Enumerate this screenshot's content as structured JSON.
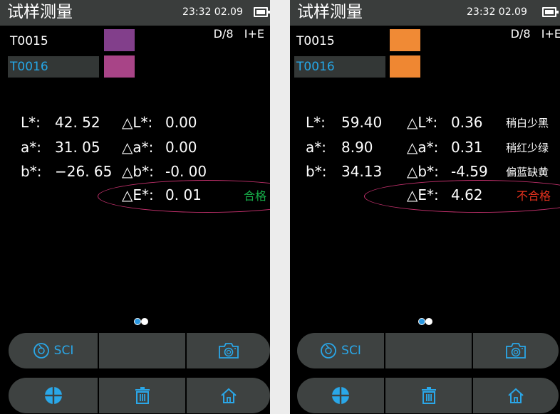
{
  "colors": {
    "accent": "#2aa7e8",
    "pass": "#16b04a",
    "fail": "#e8321e",
    "ellipse": "#c6316e",
    "bar": "#3e4241"
  },
  "panels": [
    {
      "title": "试样测量",
      "time": "23:32 02.09",
      "mode": "D/8   I+E",
      "samples": [
        {
          "name": "T0015",
          "color": "#823f8b"
        },
        {
          "name": "T0016",
          "color": "#a84487"
        }
      ],
      "metrics": [
        {
          "label": "L*:",
          "value": "42. 52",
          "delta_label": "△L*:",
          "delta_value": "0.00",
          "note": ""
        },
        {
          "label": "a*:",
          "value": "31. 05",
          "delta_label": "△a*:",
          "delta_value": "0.00",
          "note": ""
        },
        {
          "label": "b*:",
          "value": "−26. 65",
          "delta_label": "△b*:",
          "delta_value": "-0. 00",
          "note": ""
        }
      ],
      "delta_e": {
        "label": "△E*:",
        "value": "0. 01"
      },
      "verdict": {
        "text": "合格",
        "status": "pass"
      },
      "sci_label": "SCI",
      "icons": [
        "sci-icon",
        "camera-icon",
        "crosshair-icon",
        "trash-icon",
        "home-icon"
      ]
    },
    {
      "title": "试样测量",
      "time": "23:32 02.09",
      "mode": "D/8   I+E",
      "samples": [
        {
          "name": "T0015",
          "color": "#f08a35"
        },
        {
          "name": "T0016",
          "color": "#ef8732"
        }
      ],
      "metrics": [
        {
          "label": "L*:",
          "value": "59.40",
          "delta_label": "△L*:",
          "delta_value": "0.36",
          "note": "稍白少黑"
        },
        {
          "label": "a*:",
          "value": "8.90",
          "delta_label": "△a*:",
          "delta_value": "0.31",
          "note": "稍红少绿"
        },
        {
          "label": "b*:",
          "value": "34.13",
          "delta_label": "△b*:",
          "delta_value": "-4.59",
          "note": "偏蓝缺黄"
        }
      ],
      "delta_e": {
        "label": "△E*:",
        "value": "4.62"
      },
      "verdict": {
        "text": "不合格",
        "status": "fail"
      },
      "sci_label": "SCI",
      "icons": [
        "sci-icon",
        "camera-icon",
        "crosshair-icon",
        "trash-icon",
        "home-icon"
      ]
    }
  ]
}
